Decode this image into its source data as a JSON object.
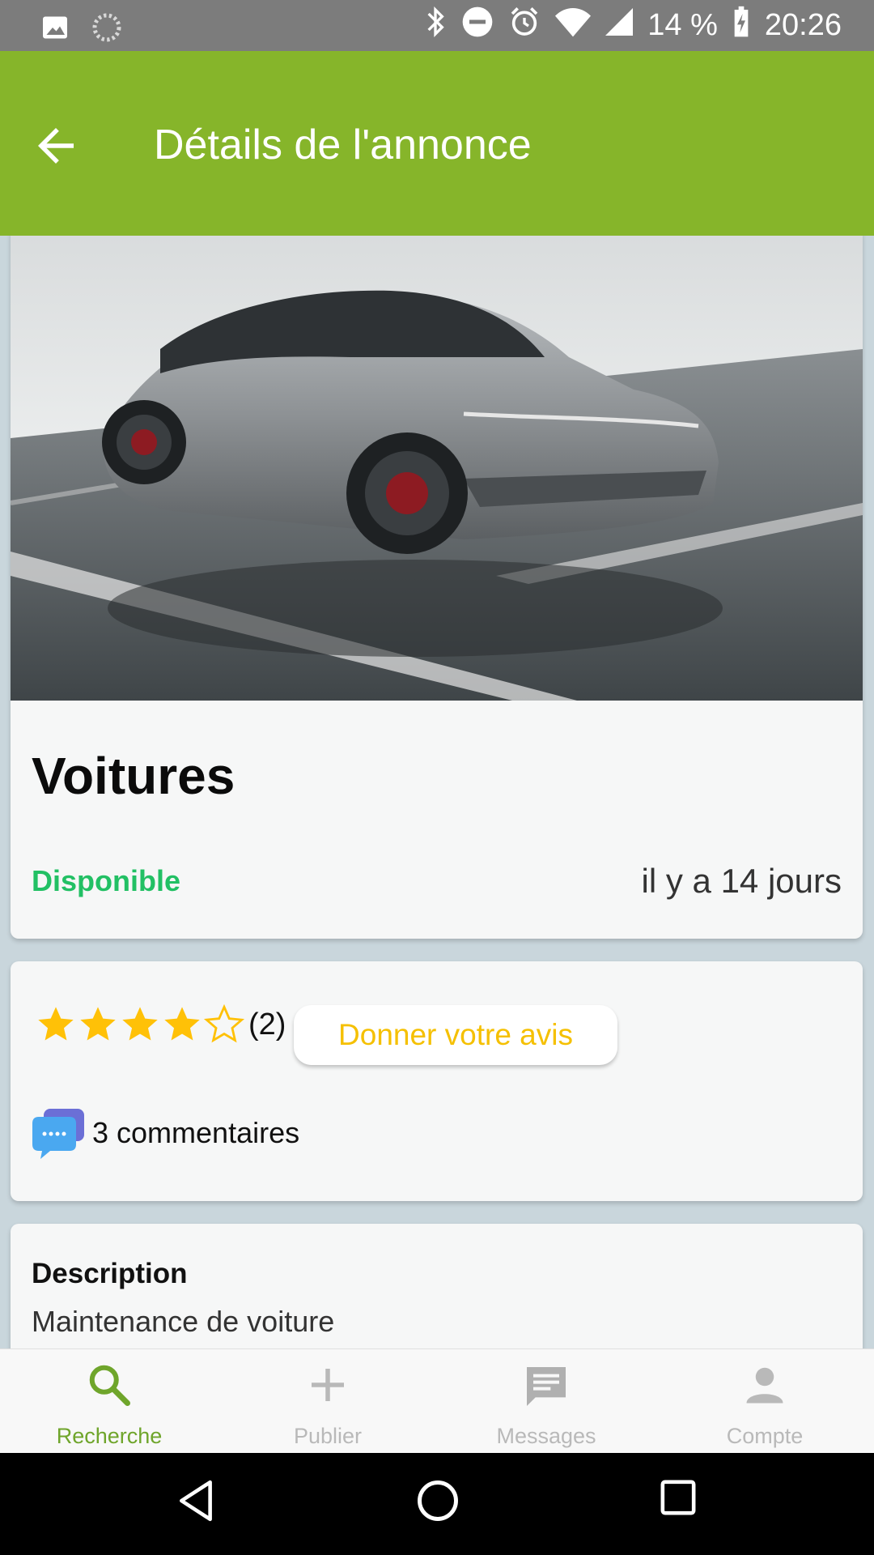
{
  "status_bar": {
    "battery_percent": "14 %",
    "time": "20:26",
    "icons": [
      "image-icon",
      "loading-icon",
      "bluetooth-icon",
      "do-not-disturb-icon",
      "alarm-icon",
      "wifi-icon",
      "signal-icon",
      "battery-charging-icon"
    ]
  },
  "app_bar": {
    "title": "Détails de l'annonce",
    "background": "#86b52a"
  },
  "listing": {
    "title": "Voitures",
    "availability": "Disponible",
    "availability_color": "#22c064",
    "posted": "il y a 14 jours"
  },
  "rating": {
    "stars": 4,
    "max_stars": 5,
    "count_label": "(2)",
    "review_button": "Donner votre avis",
    "comments_label": "3 commentaires"
  },
  "description": {
    "heading": "Description",
    "text": "Maintenance de voiture"
  },
  "bottom_nav": {
    "items": [
      {
        "label": "Recherche",
        "icon": "search-icon",
        "active": true
      },
      {
        "label": "Publier",
        "icon": "plus-icon",
        "active": false
      },
      {
        "label": "Messages",
        "icon": "chat-icon",
        "active": false
      },
      {
        "label": "Compte",
        "icon": "person-icon",
        "active": false
      }
    ],
    "active_color": "#6fa52b"
  }
}
